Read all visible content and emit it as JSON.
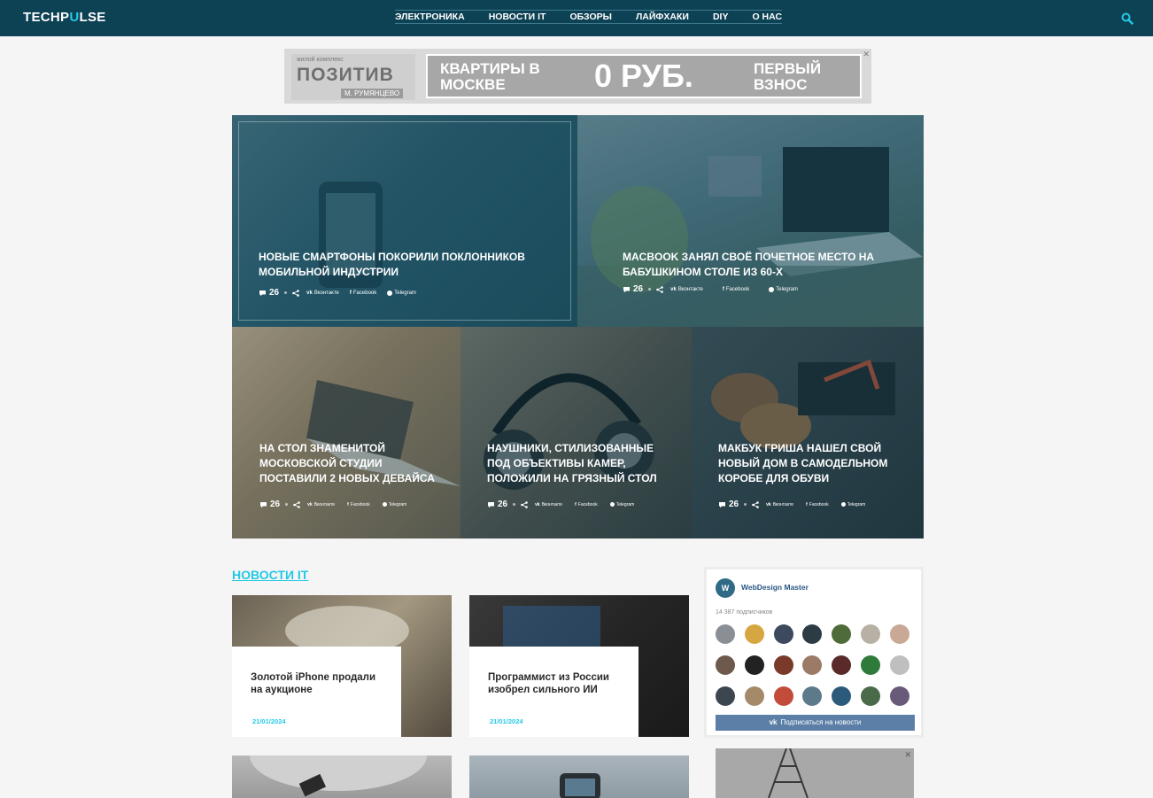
{
  "header": {
    "logo_part1": "TECHP",
    "logo_accent": "U",
    "logo_part2": "LSE",
    "nav": [
      "ЭЛЕКТРОНИКА",
      "НОВОСТИ IT",
      "ОБЗОРЫ",
      "ЛАЙФХАКИ",
      "DIY",
      "О НАС"
    ],
    "search_icon": "search-icon"
  },
  "ad_top": {
    "small": "жилой комплекс",
    "brand": "ПОЗИТИВ",
    "location": "М. РУМЯНЦЕВО",
    "left_text": "КВАРТИРЫ В МОСКВЕ",
    "center_text": "0 РУБ.",
    "right_text": "ПЕРВЫЙ ВЗНОС",
    "close": "✕"
  },
  "featured": [
    {
      "title": "НОВЫЕ СМАРТФОНЫ ПОКОРИЛИ ПОКЛОННИКОВ МОБИЛЬНОЙ ИНДУСТРИИ",
      "comments": "26",
      "vk": "Вконтакте",
      "fb": "Facebook",
      "tg": "Telegram"
    },
    {
      "title": "MACBOOK ЗАНЯЛ СВОЁ ПОЧЕТНОЕ МЕСТО НА БАБУШКИНОМ СТОЛЕ ИЗ 60-х",
      "comments": "26",
      "vk": "Вконтакте",
      "fb": "Facebook",
      "tg": "Telegram"
    },
    {
      "title": "НА СТОЛ ЗНАМЕНИТОЙ МОСКОВСКОЙ СТУДИИ ПОСТАВИЛИ 2 НОВЫХ ДЕВАЙСА",
      "comments": "26",
      "vk": "Вконтакте",
      "fb": "Facebook",
      "tg": "Telegram"
    },
    {
      "title": "НАУШНИКИ, СТИЛИЗОВАННЫЕ ПОД ОБЪЕКТИВЫ КАМЕР, ПОЛОЖИЛИ НА ГРЯЗНЫЙ СТОЛ",
      "comments": "26",
      "vk": "Вконтакте",
      "fb": "Facebook",
      "tg": "Telegram"
    },
    {
      "title": "МАКБУК ГРИША НАШЕЛ СВОЙ НОВЫЙ ДОМ В САМОДЕЛЬНОМ КОРОБЕ ДЛЯ ОБУВИ",
      "comments": "26",
      "vk": "Вконтакте",
      "fb": "Facebook",
      "tg": "Telegram"
    }
  ],
  "section": {
    "title": "НОВОСТИ IT",
    "cards": [
      {
        "title": "Золотой iPhone продали на аукционе",
        "date": "21/01/2024"
      },
      {
        "title": "Программист из России изобрел сильного ИИ",
        "date": "21/01/2024"
      }
    ]
  },
  "widget": {
    "logo": "W",
    "name": "WebDesign Master",
    "subscribers": "14 387 подписчиков",
    "button": "Подписаться на новости",
    "avatar_colors": [
      "#8a8f96",
      "#d6a640",
      "#3b4a5c",
      "#2c3b44",
      "#4f6b3a",
      "#b8b0a4",
      "#c9a896",
      "#6d5a4c",
      "#222222",
      "#7a3a2a",
      "#9b7a66",
      "#5a2a2a",
      "#2e7a3a",
      "#bfbfbf",
      "#3c4650",
      "#a58a6a",
      "#c24b3a",
      "#5d7a8a",
      "#2b5a7a",
      "#4a6a4a",
      "#6a5a7a"
    ]
  }
}
